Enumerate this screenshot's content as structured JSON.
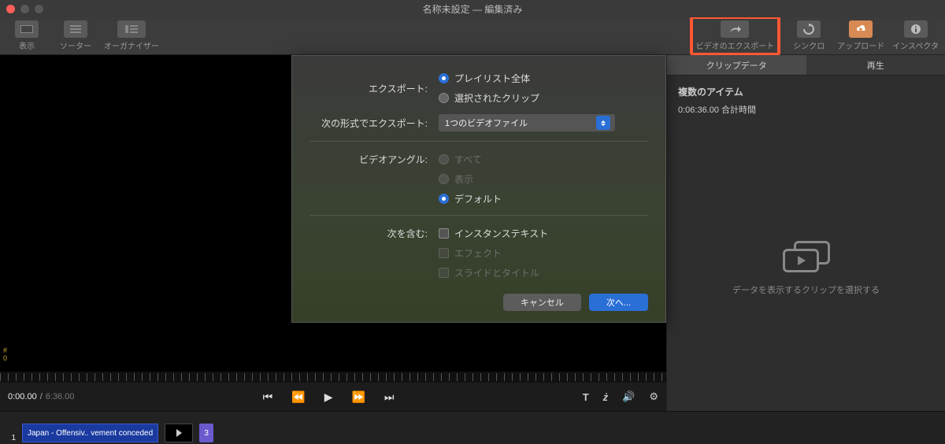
{
  "window": {
    "title": "名称未設定 — 編集済み"
  },
  "toolbar": {
    "display": "表示",
    "sorter": "ソーター",
    "organizer": "オーガナイザー",
    "export_video": "ビデオのエクスポート",
    "sync": "シンクロ",
    "upload": "アップロード",
    "inspector": "インスペクタ"
  },
  "dialog": {
    "export_label": "エクスポート:",
    "export_opts": {
      "playlist_all": "プレイリスト全体",
      "selected_clips": "選択されたクリップ"
    },
    "export_format_label": "次の形式でエクスポート:",
    "export_format_value": "1つのビデオファイル",
    "video_angle_label": "ビデオアングル:",
    "video_angle_opts": {
      "all": "すべて",
      "display": "表示",
      "default": "デフォルト"
    },
    "include_label": "次を含む:",
    "include_opts": {
      "instance_text": "インスタンステキスト",
      "effects": "エフェクト",
      "slides_titles": "スライドとタイトル"
    },
    "cancel": "キャンセル",
    "next": "次へ..."
  },
  "inspector": {
    "tab_clipdata": "クリップデータ",
    "tab_playback": "再生",
    "multi_items": "複数のアイテム",
    "duration": "0:06:36.00 合計時間",
    "placeholder": "データを表示するクリップを選択する"
  },
  "transport": {
    "current": "0:00.00",
    "sep": " / ",
    "total": "6:36.00",
    "text_btn": "T"
  },
  "timeline": {
    "index": "1",
    "clip_name": "Japan - Offensiv.. vement conceded",
    "badge": "3"
  },
  "marker": {
    "hash": "#",
    "zero": "0"
  }
}
